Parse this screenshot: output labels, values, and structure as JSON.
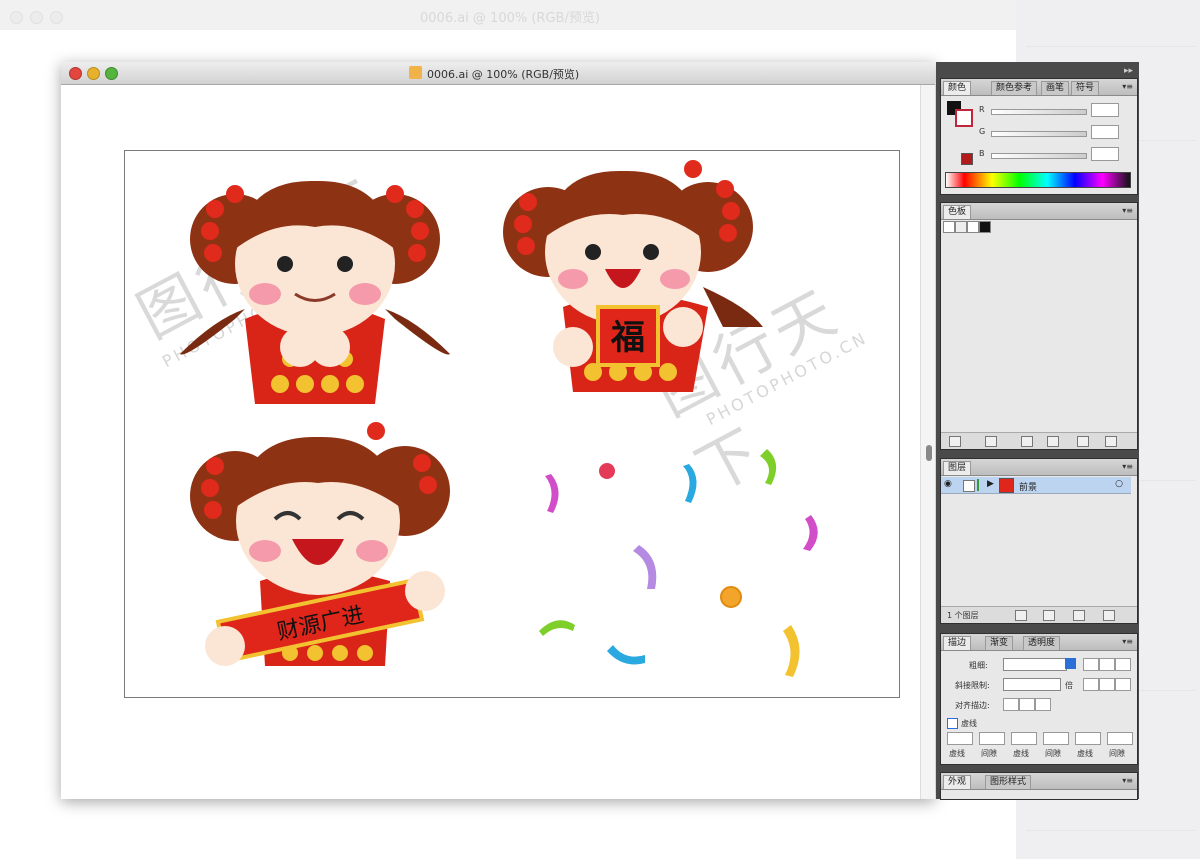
{
  "background_window": {
    "title": "0006.ai @ 100% (RGB/预览)"
  },
  "window": {
    "title": "0006.ai @ 100% (RGB/预览)"
  },
  "artwork": {
    "scroll_text": [
      "福",
      "财源广进"
    ],
    "watermark": {
      "brand": "图行天下",
      "sub": "PHOTOPHOTO.CN"
    }
  },
  "color_panel": {
    "tabs": [
      "颜色",
      "颜色参考",
      "画笔",
      "符号"
    ],
    "channels": [
      "R",
      "G",
      "B"
    ]
  },
  "swatches_panel": {
    "tab": "色板"
  },
  "layers_panel": {
    "tab": "图层",
    "layer_name": "前景",
    "footer": "1 个图层"
  },
  "stroke_panel": {
    "tabs": [
      "描边",
      "渐变",
      "透明度"
    ],
    "weight_label": "粗细:",
    "miter_label": "斜接限制:",
    "miter_unit": "倍",
    "align_label": "对齐描边:",
    "dashed_label": "虚线",
    "dash_labels": [
      "虚线",
      "间隙",
      "虚线",
      "间隙",
      "虚线",
      "间隙"
    ]
  },
  "appearance_panel": {
    "tabs": [
      "外观",
      "图形样式"
    ]
  },
  "colors": {
    "accent_red": "#c0263a",
    "fill_red": "#b21b1b",
    "layer_highlight": "#bcd4f0"
  }
}
